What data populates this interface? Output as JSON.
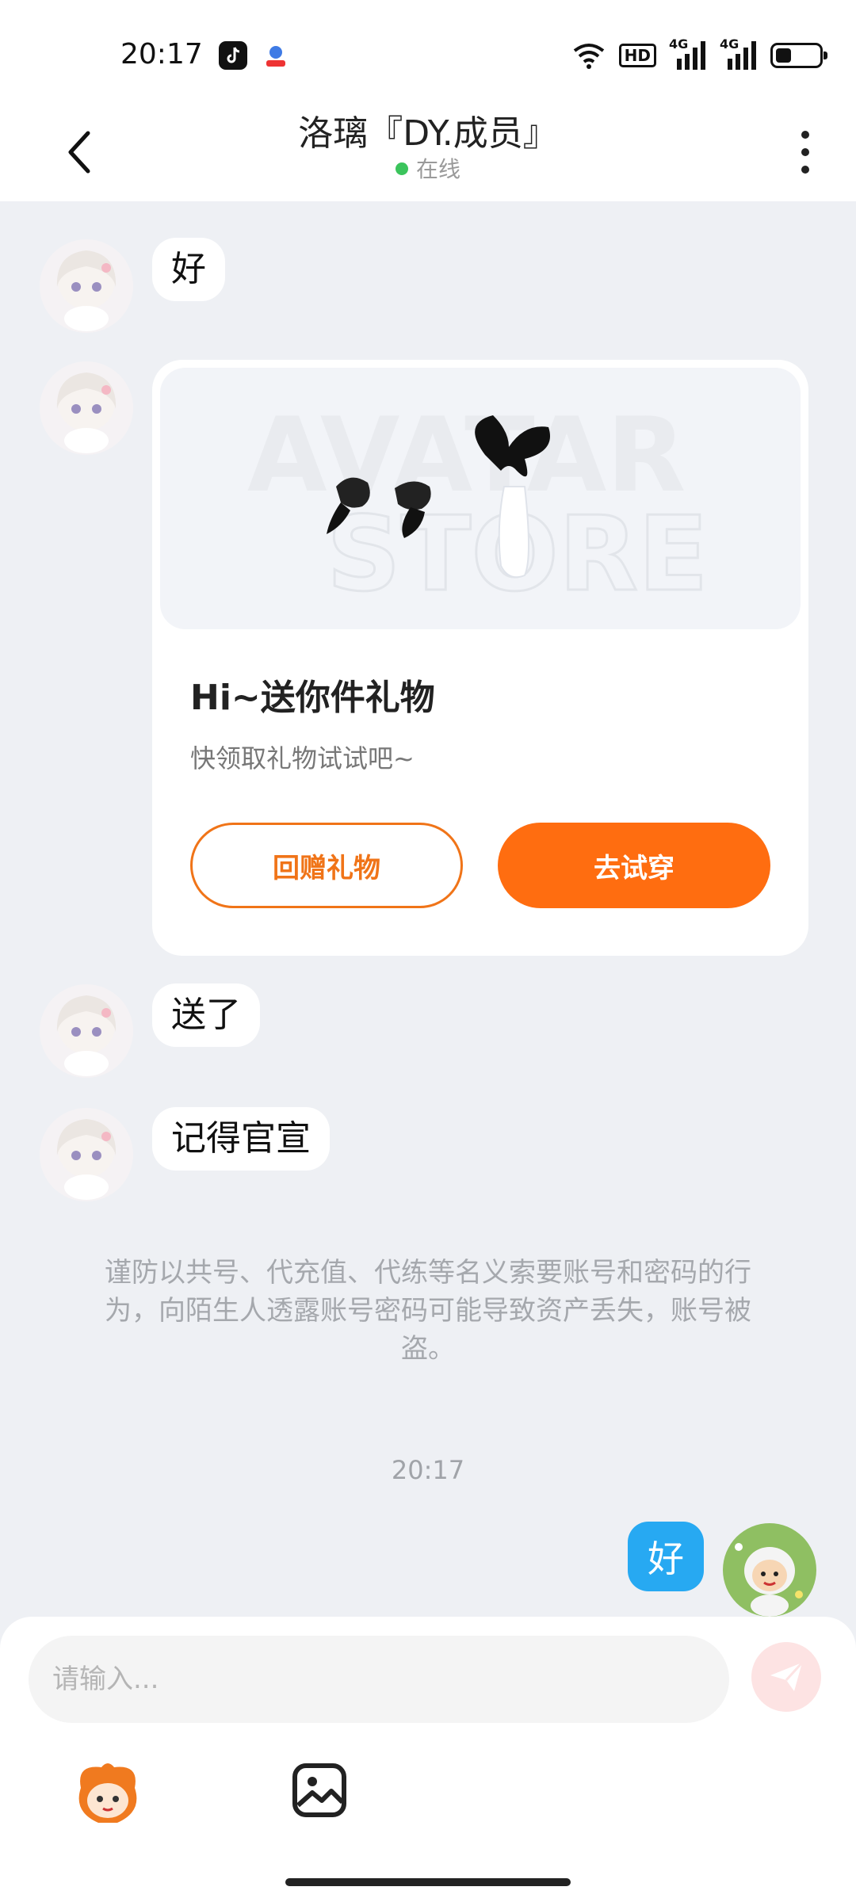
{
  "status_bar": {
    "time": "20:17",
    "hd_label": "HD",
    "signal_label_1": "4G",
    "signal_label_2": "4G",
    "battery_level_percent": 35
  },
  "header": {
    "title": "洛璃『DY.成员』",
    "status": "在线"
  },
  "messages": {
    "msg1": "好",
    "msg2": "送了",
    "msg3": "记得官宣",
    "outgoing": "好"
  },
  "gift_card": {
    "title": "Hi~送你件礼物",
    "subtitle": "快领取礼物试试吧~",
    "return_button": "回赠礼物",
    "try_button": "去试穿",
    "watermark_line1": "AVATAR",
    "watermark_line2": "STORE"
  },
  "warning": "谨防以共号、代充值、代练等名义索要账号和密码的行为，向陌生人透露账号密码可能导致资产丢失，账号被盗。",
  "timestamp": "20:17",
  "input": {
    "placeholder": "请输入..."
  },
  "colors": {
    "accent_orange": "#ff6d10",
    "outgoing_blue": "#27a9f2",
    "online_green": "#3bc45c"
  },
  "icons": [
    "tiktok-icon",
    "app-icon",
    "wifi-icon",
    "signal-icon",
    "battery-icon",
    "back-icon",
    "more-icon",
    "send-icon",
    "mascot-icon",
    "image-icon"
  ]
}
